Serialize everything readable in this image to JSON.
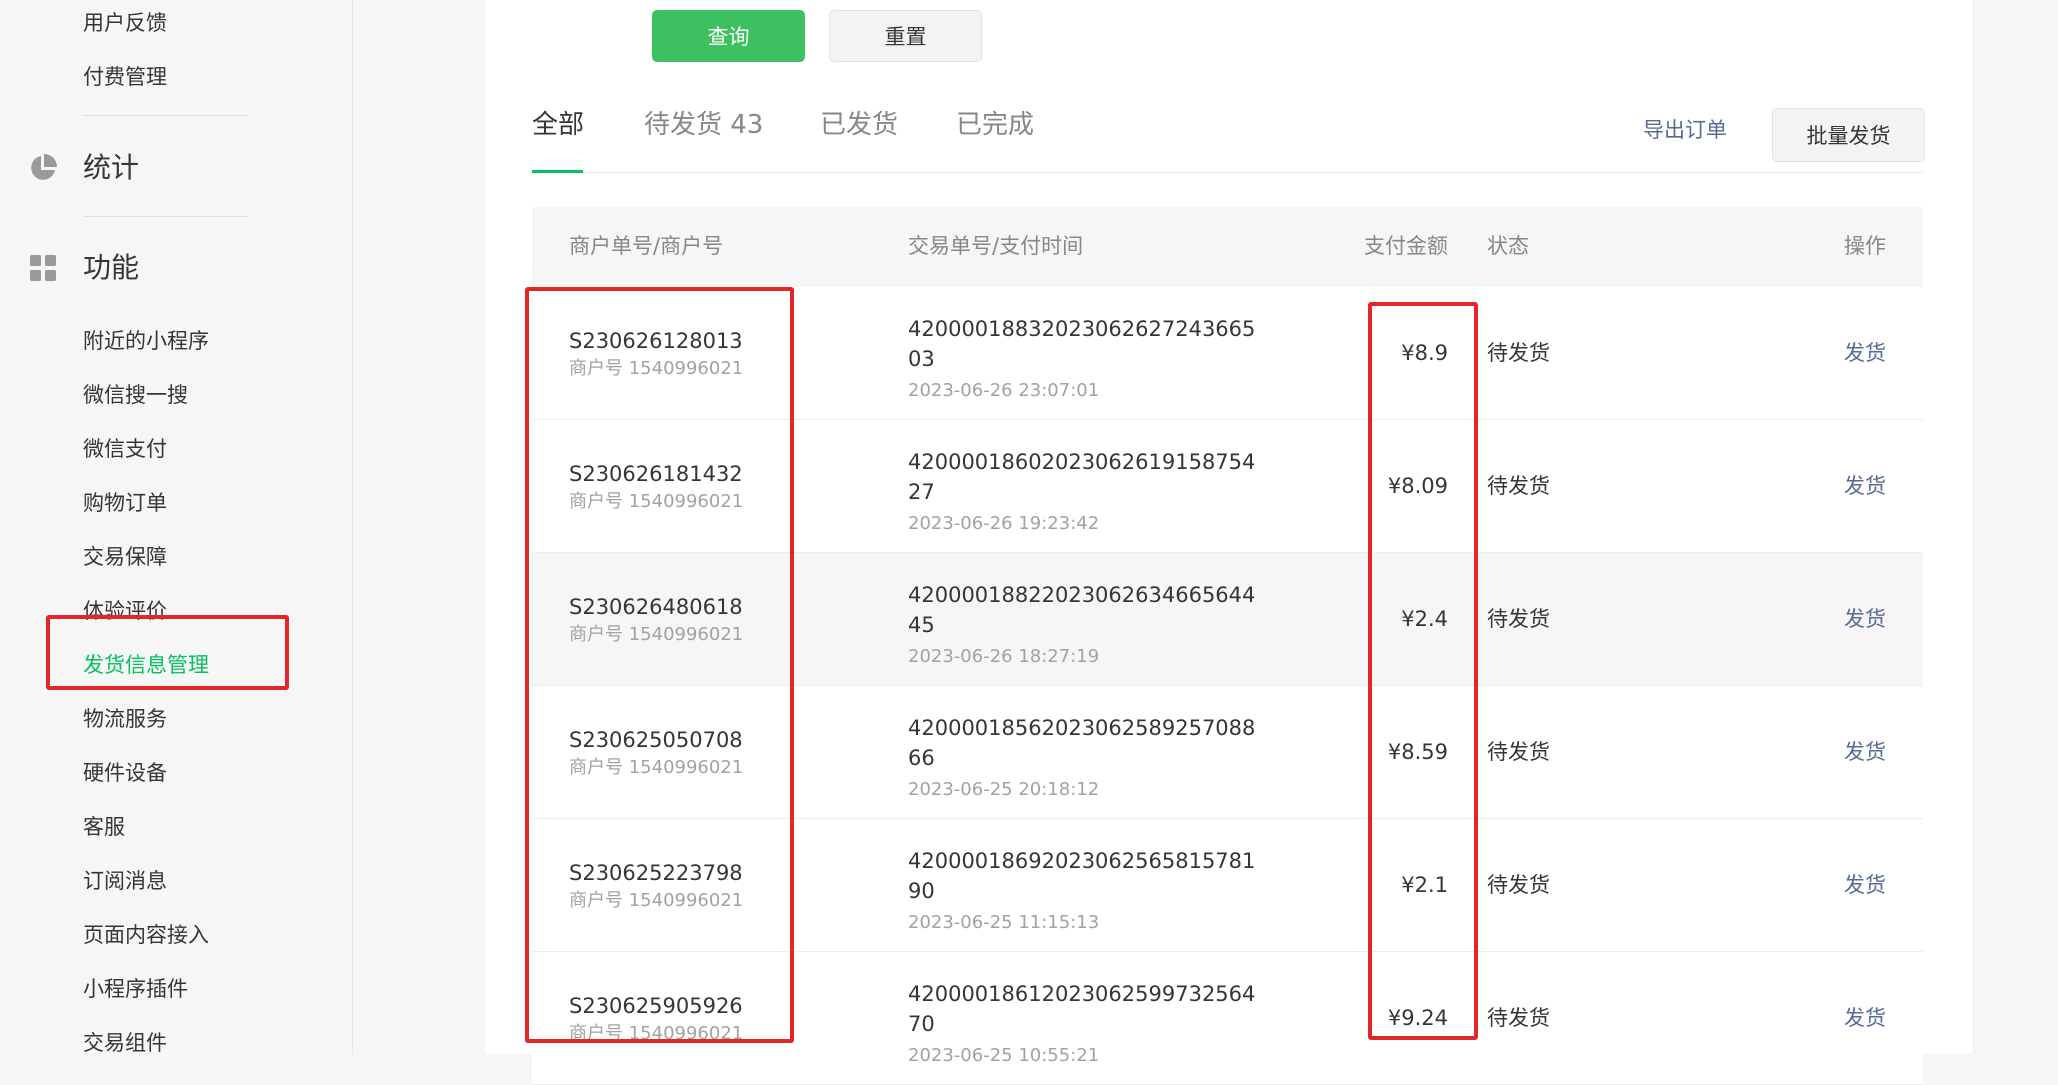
{
  "sidebar": {
    "top_items": [
      "用户反馈",
      "付费管理"
    ],
    "stats_label": "统计",
    "func_label": "功能",
    "func_items": [
      "附近的小程序",
      "微信搜一搜",
      "微信支付",
      "购物订单",
      "交易保障",
      "体验评价",
      "发货信息管理",
      "物流服务",
      "硬件设备",
      "客服",
      "订阅消息",
      "页面内容接入",
      "小程序插件",
      "交易组件"
    ],
    "active_item": "发货信息管理"
  },
  "toolbar": {
    "query_label": "查询",
    "reset_label": "重置"
  },
  "tabs": [
    {
      "label": "全部"
    },
    {
      "label": "待发货 43"
    },
    {
      "label": "已发货"
    },
    {
      "label": "已完成"
    }
  ],
  "actions": {
    "export_label": "导出订单",
    "batch_ship_label": "批量发货"
  },
  "table": {
    "headers": {
      "order": "商户单号/商户号",
      "txn": "交易单号/支付时间",
      "amount": "支付金额",
      "status": "状态",
      "op": "操作"
    },
    "rows": [
      {
        "order_no": "S230626128013",
        "merchant": "商户号 1540996021",
        "txn_line1": "42000018832023062627243665",
        "txn_line2": "03",
        "time": "2023-06-26 23:07:01",
        "amount": "¥8.9",
        "status": "待发货",
        "op": "发货"
      },
      {
        "order_no": "S230626181432",
        "merchant": "商户号 1540996021",
        "txn_line1": "42000018602023062619158754",
        "txn_line2": "27",
        "time": "2023-06-26 19:23:42",
        "amount": "¥8.09",
        "status": "待发货",
        "op": "发货"
      },
      {
        "order_no": "S230626480618",
        "merchant": "商户号 1540996021",
        "txn_line1": "42000018822023062634665644",
        "txn_line2": "45",
        "time": "2023-06-26 18:27:19",
        "amount": "¥2.4",
        "status": "待发货",
        "op": "发货"
      },
      {
        "order_no": "S230625050708",
        "merchant": "商户号 1540996021",
        "txn_line1": "42000018562023062589257088",
        "txn_line2": "66",
        "time": "2023-06-25 20:18:12",
        "amount": "¥8.59",
        "status": "待发货",
        "op": "发货"
      },
      {
        "order_no": "S230625223798",
        "merchant": "商户号 1540996021",
        "txn_line1": "42000018692023062565815781",
        "txn_line2": "90",
        "time": "2023-06-25 11:15:13",
        "amount": "¥2.1",
        "status": "待发货",
        "op": "发货"
      },
      {
        "order_no": "S230625905926",
        "merchant": "商户号 1540996021",
        "txn_line1": "42000018612023062599732564",
        "txn_line2": "70",
        "time": "2023-06-25 10:55:21",
        "amount": "¥9.24",
        "status": "待发货",
        "op": "发货"
      }
    ]
  },
  "colors": {
    "accent": "#07c160",
    "link": "#576b95",
    "highlight_box": "#e3262a"
  }
}
